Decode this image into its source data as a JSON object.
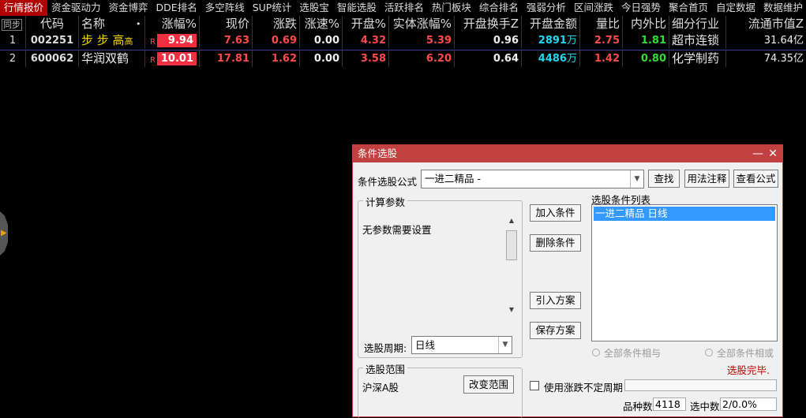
{
  "menu": [
    "行情报价",
    "资金驱动力",
    "资金博弈",
    "DDE排名",
    "多空阵线",
    "SUP统计",
    "选股宝",
    "智能选股",
    "活跃排名",
    "热门板块",
    "综合排名",
    "强弱分析",
    "区间涨跌",
    "今日强势",
    "聚合首页",
    "自定数据",
    "数据维护"
  ],
  "table": {
    "sync_label": "同步",
    "headers": [
      "代码",
      "名称",
      "•",
      "涨幅%",
      "现价",
      "涨跌",
      "涨速%",
      "开盘%",
      "实体涨幅%",
      "开盘换手Z",
      "开盘金额",
      "量比",
      "内外比",
      "细分行业",
      "流通市值Z"
    ],
    "rows": [
      {
        "idx": "1",
        "code": "002251",
        "name_a": "步 步 高",
        "name_b": "高",
        "rmark": "R",
        "change_pct": "9.94",
        "price": "7.63",
        "change": "0.69",
        "speed": "0.00",
        "open_pct": "4.32",
        "body_pct": "5.39",
        "open_turn": "0.96",
        "open_amt": "2891",
        "open_amt_unit": "万",
        "vol_ratio": "2.75",
        "io_ratio": "1.81",
        "industry": "超市连锁",
        "mktcap": "31.64亿"
      },
      {
        "idx": "2",
        "code": "600062",
        "name_a": "华润双鹤",
        "name_b": "",
        "rmark": "R",
        "change_pct": "10.01",
        "price": "17.81",
        "change": "1.62",
        "speed": "0.00",
        "open_pct": "3.58",
        "body_pct": "6.20",
        "open_turn": "0.64",
        "open_amt": "4486",
        "open_amt_unit": "万",
        "vol_ratio": "1.42",
        "io_ratio": "0.80",
        "industry": "化学制药",
        "mktcap": "74.35亿"
      }
    ]
  },
  "dialog": {
    "title": "条件选股",
    "minimize": "—",
    "close": "✕",
    "formula_label": "条件选股公式",
    "formula_value": "一进二精品   -",
    "btn_find": "查找",
    "btn_usage": "用法注释",
    "btn_view": "查看公式",
    "params_group": "计算参数",
    "params_text": "无参数需要设置",
    "period_label": "选股周期:",
    "period_value": "日线",
    "btn_add": "加入条件",
    "btn_delete": "删除条件",
    "btn_import": "引入方案",
    "btn_save": "保存方案",
    "list_label": "选股条件列表",
    "list_items": [
      "一进二精品  日线"
    ],
    "radio_and": "全部条件相与",
    "radio_or": "全部条件相或",
    "status": "选股完毕.",
    "scope_group": "选股范围",
    "scope_value": "沪深A股",
    "btn_change_scope": "改变范围",
    "chk_label": "使用涨跌不定周期",
    "count_label": "品种数",
    "count_value": "4118",
    "selected_label": "选中数",
    "selected_value": "2/0.0%"
  },
  "colors": {
    "accent": "#c0413f",
    "up": "#ff4a4a",
    "down": "#33dd33",
    "amount": "#22d8f0",
    "name": "#f2d300"
  }
}
